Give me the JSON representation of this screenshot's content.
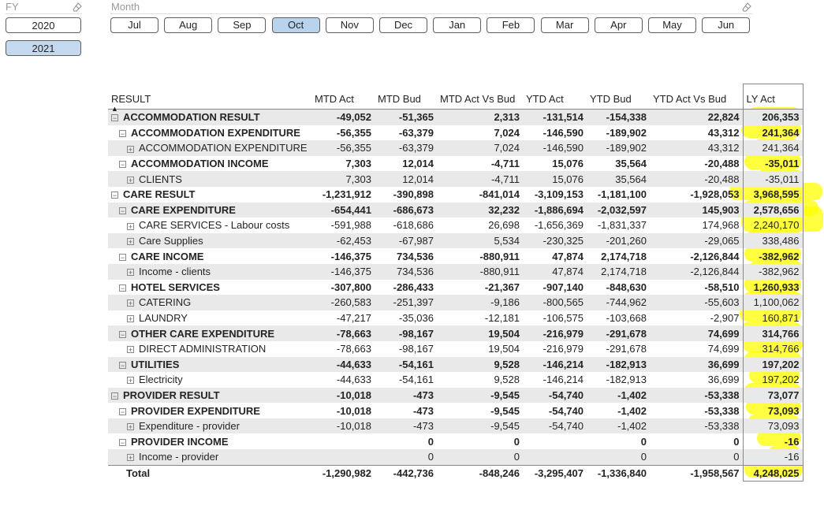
{
  "slicers": {
    "fy": {
      "title": "FY",
      "options": [
        {
          "label": "2020",
          "selected": false
        },
        {
          "label": "2021",
          "selected": true
        }
      ]
    },
    "month": {
      "title": "Month",
      "options": [
        {
          "label": "Jul",
          "selected": false
        },
        {
          "label": "Aug",
          "selected": false
        },
        {
          "label": "Sep",
          "selected": false
        },
        {
          "label": "Oct",
          "selected": true
        },
        {
          "label": "Nov",
          "selected": false
        },
        {
          "label": "Dec",
          "selected": false
        },
        {
          "label": "Jan",
          "selected": false
        },
        {
          "label": "Feb",
          "selected": false
        },
        {
          "label": "Mar",
          "selected": false
        },
        {
          "label": "Apr",
          "selected": false
        },
        {
          "label": "May",
          "selected": false
        },
        {
          "label": "Jun",
          "selected": false
        }
      ]
    }
  },
  "matrix": {
    "columns": [
      "RESULT",
      "MTD Act",
      "MTD Bud",
      "MTD Act Vs Bud",
      "YTD Act",
      "YTD Bud",
      "YTD Act Vs Bud",
      "LY Act"
    ],
    "rows": [
      {
        "label": "ACCOMMODATION RESULT",
        "level": 0,
        "bold": true,
        "expander": "minus",
        "values": [
          "-49,052",
          "-51,365",
          "2,313",
          "-131,514",
          "-154,338",
          "22,824",
          "206,353"
        ]
      },
      {
        "label": "ACCOMMODATION EXPENDITURE",
        "level": 1,
        "bold": true,
        "expander": "minus",
        "values": [
          "-56,355",
          "-63,379",
          "7,024",
          "-146,590",
          "-189,902",
          "43,312",
          "241,364"
        ]
      },
      {
        "label": "ACCOMMODATION EXPENDITURE",
        "level": 2,
        "bold": false,
        "expander": "plus",
        "values": [
          "-56,355",
          "-63,379",
          "7,024",
          "-146,590",
          "-189,902",
          "43,312",
          "241,364"
        ]
      },
      {
        "label": "ACCOMMODATION INCOME",
        "level": 1,
        "bold": true,
        "expander": "minus",
        "values": [
          "7,303",
          "12,014",
          "-4,711",
          "15,076",
          "35,564",
          "-20,488",
          "-35,011"
        ]
      },
      {
        "label": "CLIENTS",
        "level": 2,
        "bold": false,
        "expander": "plus",
        "values": [
          "7,303",
          "12,014",
          "-4,711",
          "15,076",
          "35,564",
          "-20,488",
          "-35,011"
        ]
      },
      {
        "label": "CARE RESULT",
        "level": 0,
        "bold": true,
        "expander": "minus",
        "values": [
          "-1,231,912",
          "-390,898",
          "-841,014",
          "-3,109,153",
          "-1,181,100",
          "-1,928,053",
          "3,968,595"
        ]
      },
      {
        "label": "CARE EXPENDITURE",
        "level": 1,
        "bold": true,
        "expander": "minus",
        "values": [
          "-654,441",
          "-686,673",
          "32,232",
          "-1,886,694",
          "-2,032,597",
          "145,903",
          "2,578,656"
        ]
      },
      {
        "label": "CARE SERVICES - Labour costs",
        "level": 2,
        "bold": false,
        "expander": "plus",
        "values": [
          "-591,988",
          "-618,686",
          "26,698",
          "-1,656,369",
          "-1,831,337",
          "174,968",
          "2,240,170"
        ]
      },
      {
        "label": "Care Supplies",
        "level": 2,
        "bold": false,
        "expander": "plus",
        "values": [
          "-62,453",
          "-67,987",
          "5,534",
          "-230,325",
          "-201,260",
          "-29,065",
          "338,486"
        ]
      },
      {
        "label": "CARE INCOME",
        "level": 1,
        "bold": true,
        "expander": "minus",
        "values": [
          "-146,375",
          "734,536",
          "-880,911",
          "47,874",
          "2,174,718",
          "-2,126,844",
          "-382,962"
        ]
      },
      {
        "label": "Income - clients",
        "level": 2,
        "bold": false,
        "expander": "plus",
        "values": [
          "-146,375",
          "734,536",
          "-880,911",
          "47,874",
          "2,174,718",
          "-2,126,844",
          "-382,962"
        ]
      },
      {
        "label": "HOTEL SERVICES",
        "level": 1,
        "bold": true,
        "expander": "minus",
        "values": [
          "-307,800",
          "-286,433",
          "-21,367",
          "-907,140",
          "-848,630",
          "-58,510",
          "1,260,933"
        ]
      },
      {
        "label": "CATERING",
        "level": 2,
        "bold": false,
        "expander": "plus",
        "values": [
          "-260,583",
          "-251,397",
          "-9,186",
          "-800,565",
          "-744,962",
          "-55,603",
          "1,100,062"
        ]
      },
      {
        "label": "LAUNDRY",
        "level": 2,
        "bold": false,
        "expander": "plus",
        "values": [
          "-47,217",
          "-35,036",
          "-12,181",
          "-106,575",
          "-103,668",
          "-2,907",
          "160,871"
        ]
      },
      {
        "label": "OTHER CARE EXPENDITURE",
        "level": 1,
        "bold": true,
        "expander": "minus",
        "values": [
          "-78,663",
          "-98,167",
          "19,504",
          "-216,979",
          "-291,678",
          "74,699",
          "314,766"
        ]
      },
      {
        "label": "DIRECT ADMINISTRATION",
        "level": 2,
        "bold": false,
        "expander": "plus",
        "values": [
          "-78,663",
          "-98,167",
          "19,504",
          "-216,979",
          "-291,678",
          "74,699",
          "314,766"
        ]
      },
      {
        "label": "UTILITIES",
        "level": 1,
        "bold": true,
        "expander": "minus",
        "values": [
          "-44,633",
          "-54,161",
          "9,528",
          "-146,214",
          "-182,913",
          "36,699",
          "197,202"
        ]
      },
      {
        "label": "Electricity",
        "level": 2,
        "bold": false,
        "expander": "plus",
        "values": [
          "-44,633",
          "-54,161",
          "9,528",
          "-146,214",
          "-182,913",
          "36,699",
          "197,202"
        ]
      },
      {
        "label": "PROVIDER RESULT",
        "level": 0,
        "bold": true,
        "expander": "minus",
        "values": [
          "-10,018",
          "-473",
          "-9,545",
          "-54,740",
          "-1,402",
          "-53,338",
          "73,077"
        ]
      },
      {
        "label": "PROVIDER EXPENDITURE",
        "level": 1,
        "bold": true,
        "expander": "minus",
        "values": [
          "-10,018",
          "-473",
          "-9,545",
          "-54,740",
          "-1,402",
          "-53,338",
          "73,093"
        ]
      },
      {
        "label": "Expenditure - provider",
        "level": 2,
        "bold": false,
        "expander": "plus",
        "values": [
          "-10,018",
          "-473",
          "-9,545",
          "-54,740",
          "-1,402",
          "-53,338",
          "73,093"
        ]
      },
      {
        "label": "PROVIDER INCOME",
        "level": 1,
        "bold": true,
        "expander": "minus",
        "values": [
          "",
          "0",
          "0",
          "",
          "0",
          "0",
          "-16"
        ]
      },
      {
        "label": "Income - provider",
        "level": 2,
        "bold": false,
        "expander": "plus",
        "values": [
          "",
          "0",
          "0",
          "",
          "0",
          "0",
          "-16"
        ]
      }
    ],
    "total": {
      "label": "Total",
      "values": [
        "-1,290,982",
        "-442,736",
        "-848,246",
        "-3,295,407",
        "-1,336,840",
        "-1,958,567",
        "4,248,025"
      ]
    }
  },
  "colors": {
    "highlight": "#ffff00",
    "selected_slicer": "#c4d8ee",
    "row_shade": "#e9e9e9"
  }
}
